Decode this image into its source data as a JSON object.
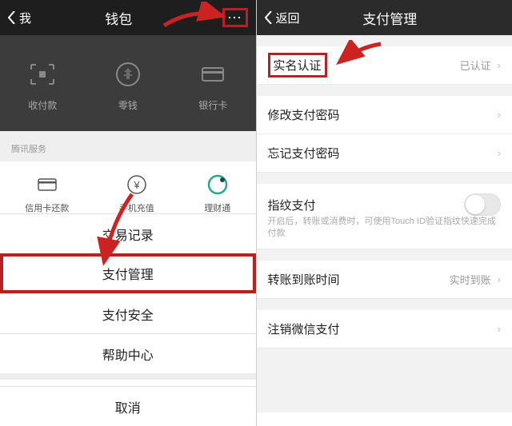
{
  "left": {
    "back": "我",
    "title": "钱包",
    "more_icon": "⋯",
    "topItems": [
      {
        "label": "收付款"
      },
      {
        "label": "零钱"
      },
      {
        "label": "银行卡"
      }
    ],
    "servicesHeader": "腾讯服务",
    "services": [
      {
        "label": "信用卡还款"
      },
      {
        "label": "手机充值"
      },
      {
        "label": "理财通"
      }
    ],
    "sheet": {
      "items": [
        {
          "label": "交易记录"
        },
        {
          "label": "支付管理",
          "highlight": true
        },
        {
          "label": "支付安全"
        },
        {
          "label": "帮助中心"
        }
      ],
      "cancel": "取消"
    }
  },
  "right": {
    "back": "返回",
    "title": "支付管理",
    "groups": [
      [
        {
          "label": "实名认证",
          "value": "已认证",
          "highlight": true
        }
      ],
      [
        {
          "label": "修改支付密码"
        },
        {
          "label": "忘记支付密码"
        }
      ],
      [
        {
          "label": "指纹支付",
          "switch": true,
          "sub": "开启后，转账或消费时，可使用Touch ID验证指纹快速完成付款"
        }
      ],
      [
        {
          "label": "转账到账时间",
          "value": "实时到账"
        }
      ],
      [
        {
          "label": "注销微信支付"
        }
      ]
    ]
  }
}
